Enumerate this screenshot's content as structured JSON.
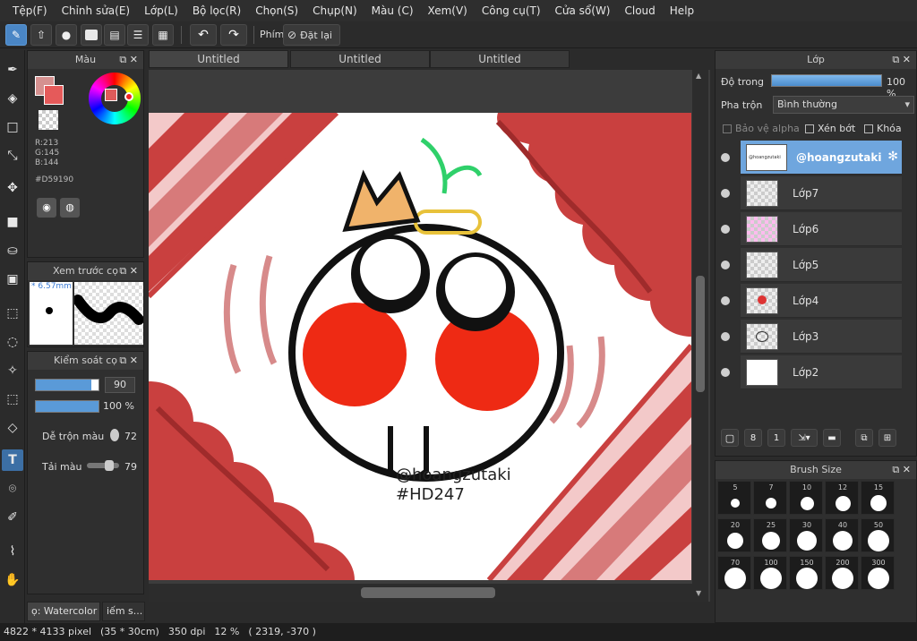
{
  "menu": [
    "Tệp(F)",
    "Chỉnh sửa(E)",
    "Lớp(L)",
    "Bộ lọc(R)",
    "Chọn(S)",
    "Chụp(N)",
    "Màu (C)",
    "Xem(V)",
    "Công cụ(T)",
    "Cửa sổ(W)",
    "Cloud",
    "Help"
  ],
  "toolbar": {
    "key_label": "Phím",
    "reset_label": "Đặt lại"
  },
  "tabs": [
    "Untitled",
    "Untitled",
    "Untitled"
  ],
  "color_panel": {
    "title": "Màu",
    "r": "R:213",
    "g": "G:145",
    "b": "B:144",
    "hex": "#D59190",
    "swatch_color": "#D59190"
  },
  "preview_panel": {
    "title": "Xem trước cọ",
    "size": "6.57mm"
  },
  "brush_control": {
    "title": "Kiểm soát cọ",
    "size_value": "90",
    "opacity_value": "100 %",
    "blend_label": "Dễ trộn màu",
    "blend_value": "72",
    "load_label": "Tải màu",
    "load_value": "79"
  },
  "brush_tab": {
    "watercolor": "ọ: Watercolor ...",
    "other": "iếm s..."
  },
  "layer_panel": {
    "title": "Lớp",
    "opacity_label": "Độ trong",
    "opacity_value": "100 %",
    "blend_label": "Pha trộn",
    "blend_value": "Bình thường",
    "protect_alpha": "Bảo vệ alpha",
    "clip": "Xén bớt",
    "lock": "Khóa",
    "layers": [
      "@hoangzutaki",
      "Lớp7",
      "Lớp6",
      "Lớp5",
      "Lớp4",
      "Lớp3",
      "Lớp2"
    ],
    "selected_thumb_text": "@hoangzutaki"
  },
  "brush_size_panel": {
    "title": "Brush Size",
    "sizes": [
      "5",
      "7",
      "10",
      "12",
      "15",
      "20",
      "25",
      "30",
      "40",
      "50",
      "70",
      "100",
      "150",
      "200",
      "300"
    ]
  },
  "canvas": {
    "watermark_line1": "@hoangzutaki",
    "watermark_line2": "#HD247"
  },
  "status": {
    "pixels": "4822 * 4133 pixel",
    "cm": "(35 * 30cm)",
    "dpi": "350 dpi",
    "zoom": "12 %",
    "coords": "( 2319, -370 )"
  },
  "colors": {
    "accent": "#4a86c5",
    "red": "#c9403f",
    "pink": "#f2cccc",
    "dark_red": "#a03a3a"
  }
}
